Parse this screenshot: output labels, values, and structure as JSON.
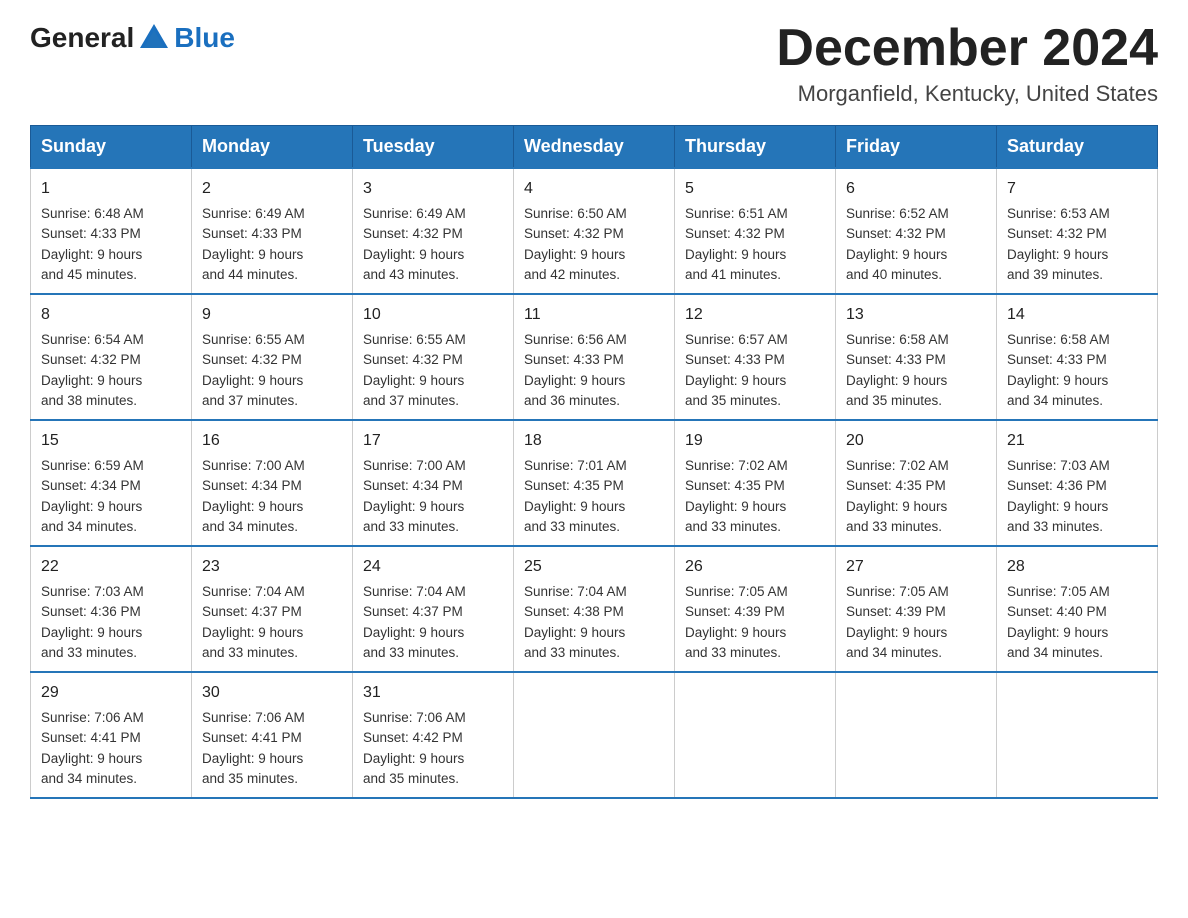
{
  "header": {
    "logo_general": "General",
    "logo_blue": "Blue",
    "title": "December 2024",
    "subtitle": "Morganfield, Kentucky, United States"
  },
  "days_of_week": [
    "Sunday",
    "Monday",
    "Tuesday",
    "Wednesday",
    "Thursday",
    "Friday",
    "Saturday"
  ],
  "weeks": [
    [
      {
        "day": "1",
        "sunrise": "6:48 AM",
        "sunset": "4:33 PM",
        "daylight": "9 hours and 45 minutes."
      },
      {
        "day": "2",
        "sunrise": "6:49 AM",
        "sunset": "4:33 PM",
        "daylight": "9 hours and 44 minutes."
      },
      {
        "day": "3",
        "sunrise": "6:49 AM",
        "sunset": "4:32 PM",
        "daylight": "9 hours and 43 minutes."
      },
      {
        "day": "4",
        "sunrise": "6:50 AM",
        "sunset": "4:32 PM",
        "daylight": "9 hours and 42 minutes."
      },
      {
        "day": "5",
        "sunrise": "6:51 AM",
        "sunset": "4:32 PM",
        "daylight": "9 hours and 41 minutes."
      },
      {
        "day": "6",
        "sunrise": "6:52 AM",
        "sunset": "4:32 PM",
        "daylight": "9 hours and 40 minutes."
      },
      {
        "day": "7",
        "sunrise": "6:53 AM",
        "sunset": "4:32 PM",
        "daylight": "9 hours and 39 minutes."
      }
    ],
    [
      {
        "day": "8",
        "sunrise": "6:54 AM",
        "sunset": "4:32 PM",
        "daylight": "9 hours and 38 minutes."
      },
      {
        "day": "9",
        "sunrise": "6:55 AM",
        "sunset": "4:32 PM",
        "daylight": "9 hours and 37 minutes."
      },
      {
        "day": "10",
        "sunrise": "6:55 AM",
        "sunset": "4:32 PM",
        "daylight": "9 hours and 37 minutes."
      },
      {
        "day": "11",
        "sunrise": "6:56 AM",
        "sunset": "4:33 PM",
        "daylight": "9 hours and 36 minutes."
      },
      {
        "day": "12",
        "sunrise": "6:57 AM",
        "sunset": "4:33 PM",
        "daylight": "9 hours and 35 minutes."
      },
      {
        "day": "13",
        "sunrise": "6:58 AM",
        "sunset": "4:33 PM",
        "daylight": "9 hours and 35 minutes."
      },
      {
        "day": "14",
        "sunrise": "6:58 AM",
        "sunset": "4:33 PM",
        "daylight": "9 hours and 34 minutes."
      }
    ],
    [
      {
        "day": "15",
        "sunrise": "6:59 AM",
        "sunset": "4:34 PM",
        "daylight": "9 hours and 34 minutes."
      },
      {
        "day": "16",
        "sunrise": "7:00 AM",
        "sunset": "4:34 PM",
        "daylight": "9 hours and 34 minutes."
      },
      {
        "day": "17",
        "sunrise": "7:00 AM",
        "sunset": "4:34 PM",
        "daylight": "9 hours and 33 minutes."
      },
      {
        "day": "18",
        "sunrise": "7:01 AM",
        "sunset": "4:35 PM",
        "daylight": "9 hours and 33 minutes."
      },
      {
        "day": "19",
        "sunrise": "7:02 AM",
        "sunset": "4:35 PM",
        "daylight": "9 hours and 33 minutes."
      },
      {
        "day": "20",
        "sunrise": "7:02 AM",
        "sunset": "4:35 PM",
        "daylight": "9 hours and 33 minutes."
      },
      {
        "day": "21",
        "sunrise": "7:03 AM",
        "sunset": "4:36 PM",
        "daylight": "9 hours and 33 minutes."
      }
    ],
    [
      {
        "day": "22",
        "sunrise": "7:03 AM",
        "sunset": "4:36 PM",
        "daylight": "9 hours and 33 minutes."
      },
      {
        "day": "23",
        "sunrise": "7:04 AM",
        "sunset": "4:37 PM",
        "daylight": "9 hours and 33 minutes."
      },
      {
        "day": "24",
        "sunrise": "7:04 AM",
        "sunset": "4:37 PM",
        "daylight": "9 hours and 33 minutes."
      },
      {
        "day": "25",
        "sunrise": "7:04 AM",
        "sunset": "4:38 PM",
        "daylight": "9 hours and 33 minutes."
      },
      {
        "day": "26",
        "sunrise": "7:05 AM",
        "sunset": "4:39 PM",
        "daylight": "9 hours and 33 minutes."
      },
      {
        "day": "27",
        "sunrise": "7:05 AM",
        "sunset": "4:39 PM",
        "daylight": "9 hours and 34 minutes."
      },
      {
        "day": "28",
        "sunrise": "7:05 AM",
        "sunset": "4:40 PM",
        "daylight": "9 hours and 34 minutes."
      }
    ],
    [
      {
        "day": "29",
        "sunrise": "7:06 AM",
        "sunset": "4:41 PM",
        "daylight": "9 hours and 34 minutes."
      },
      {
        "day": "30",
        "sunrise": "7:06 AM",
        "sunset": "4:41 PM",
        "daylight": "9 hours and 35 minutes."
      },
      {
        "day": "31",
        "sunrise": "7:06 AM",
        "sunset": "4:42 PM",
        "daylight": "9 hours and 35 minutes."
      },
      null,
      null,
      null,
      null
    ]
  ]
}
